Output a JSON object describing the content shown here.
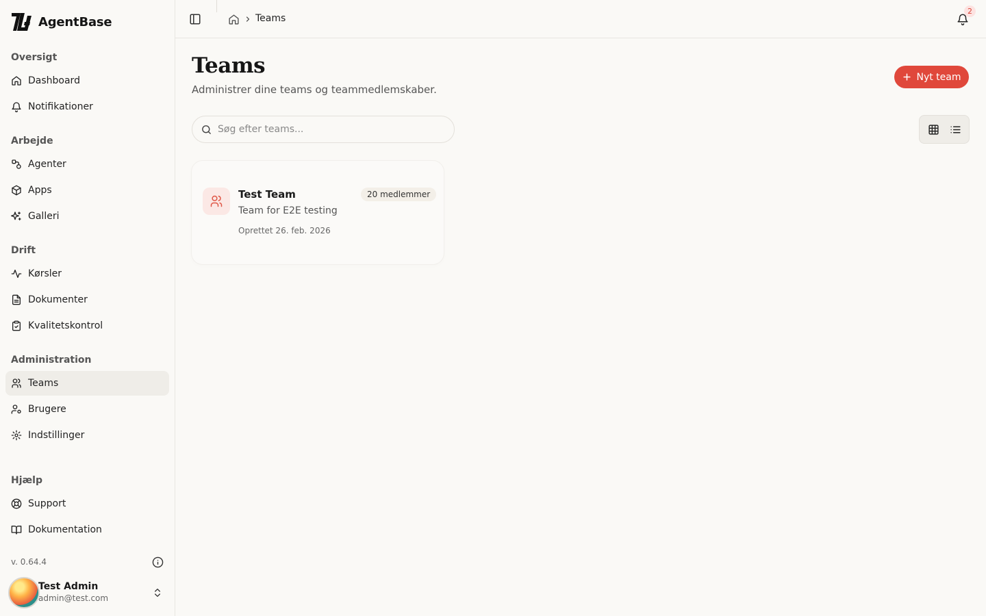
{
  "app": {
    "name": "AgentBase"
  },
  "sidebar": {
    "sections": [
      {
        "title": "Oversigt",
        "items": [
          {
            "label": "Dashboard",
            "icon": "home-icon"
          },
          {
            "label": "Notifikationer",
            "icon": "bell-icon"
          }
        ]
      },
      {
        "title": "Arbejde",
        "items": [
          {
            "label": "Agenter",
            "icon": "workflow-icon"
          },
          {
            "label": "Apps",
            "icon": "box-icon"
          },
          {
            "label": "Galleri",
            "icon": "sparkles-icon"
          }
        ]
      },
      {
        "title": "Drift",
        "items": [
          {
            "label": "Kørsler",
            "icon": "activity-icon"
          },
          {
            "label": "Dokumenter",
            "icon": "document-icon"
          },
          {
            "label": "Kvalitetskontrol",
            "icon": "clipboard-check-icon"
          }
        ]
      },
      {
        "title": "Administration",
        "items": [
          {
            "label": "Teams",
            "icon": "users-icon",
            "active": true
          },
          {
            "label": "Brugere",
            "icon": "user-cog-icon"
          },
          {
            "label": "Indstillinger",
            "icon": "gear-icon"
          }
        ]
      },
      {
        "title": "Hjælp",
        "items": [
          {
            "label": "Support",
            "icon": "lifebuoy-icon"
          },
          {
            "label": "Dokumentation",
            "icon": "book-icon"
          }
        ]
      }
    ],
    "version": "v. 0.64.4",
    "user": {
      "name": "Test Admin",
      "email": "admin@test.com"
    }
  },
  "topbar": {
    "breadcrumb": {
      "current": "Teams"
    },
    "notifications_count": "2"
  },
  "page": {
    "title": "Teams",
    "subtitle": "Administrer dine teams og teammedlemskaber.",
    "new_button": "Nyt team",
    "search": {
      "placeholder": "Søg efter teams...",
      "value": ""
    },
    "view_modes": [
      "grid-icon",
      "list-icon"
    ]
  },
  "teams": [
    {
      "name": "Test Team",
      "members": "20 medlemmer",
      "description": "Team for E2E testing",
      "created": "Oprettet 26. feb. 2026"
    }
  ],
  "colors": {
    "accent": "#e0483b",
    "background": "#faf9f6",
    "active_nav": "#efede8",
    "badge_bg": "#fde3e1"
  }
}
